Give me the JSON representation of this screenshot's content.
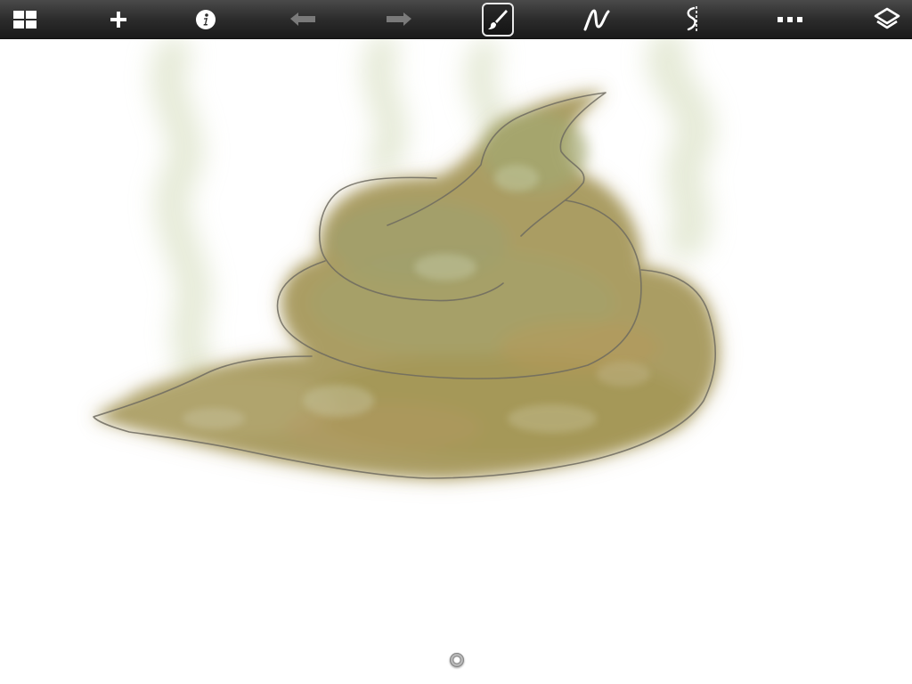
{
  "toolbar": {
    "buttons": [
      {
        "id": "gallery",
        "icon": "gallery-grid-icon",
        "enabled": true
      },
      {
        "id": "new",
        "icon": "plus-icon",
        "enabled": true
      },
      {
        "id": "info",
        "icon": "info-icon",
        "enabled": true
      },
      {
        "id": "undo",
        "icon": "undo-arrow-icon",
        "enabled": false
      },
      {
        "id": "redo",
        "icon": "redo-arrow-icon",
        "enabled": false
      },
      {
        "id": "brush",
        "icon": "paintbrush-icon",
        "enabled": true,
        "selected": true
      },
      {
        "id": "stroke",
        "icon": "stroke-curve-icon",
        "enabled": true
      },
      {
        "id": "symmetry",
        "icon": "symmetry-icon",
        "enabled": true
      },
      {
        "id": "more",
        "icon": "more-dots-icon",
        "enabled": true
      },
      {
        "id": "layers",
        "icon": "layers-icon",
        "enabled": true
      }
    ],
    "colors": {
      "icon": "#ffffff",
      "icon_disabled": "#7a7a7a",
      "background_top": "#4a4a4a",
      "background_bottom": "#1a1a1a"
    }
  },
  "canvas": {
    "background": "#ffffff",
    "drawing_colors": {
      "fill_brown": "#a89a5c",
      "fill_green": "#9aa06a",
      "fill_orange": "#b8915a",
      "smoke_green": "#d2dab8",
      "outline": "#6e6b60"
    }
  },
  "zoom_handle": {
    "icon": "zoom-handle-icon"
  }
}
